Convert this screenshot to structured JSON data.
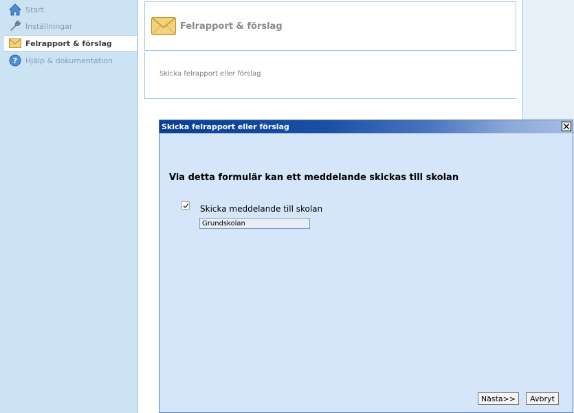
{
  "sidebar": {
    "items": [
      {
        "label": "Start",
        "icon": "home-icon"
      },
      {
        "label": "Inställningar",
        "icon": "wrench-icon"
      },
      {
        "label": "Felrapport & förslag",
        "icon": "envelope-icon",
        "active": true
      },
      {
        "label": "Hjälp & dokumentation",
        "icon": "help-icon"
      }
    ]
  },
  "main": {
    "header_title": "Felrapport & förslag",
    "header_icon": "envelope-icon",
    "content_link": "Skicka felrapport eller förslag"
  },
  "dialog": {
    "title": "Skicka felrapport eller förslag",
    "heading": "Via detta formulär kan ett meddelande skickas till skolan",
    "checkbox_label": "Skicka meddelande till skolan",
    "checkbox_checked": true,
    "school_value": "Grundskolan",
    "next_label": "Nästa>>",
    "cancel_label": "Avbryt"
  },
  "colors": {
    "sidebar_bg": "#cce3f3",
    "dialog_bg": "#d6e6fa",
    "titlebar_start": "#0a3f97",
    "titlebar_end": "#a6bde3"
  }
}
